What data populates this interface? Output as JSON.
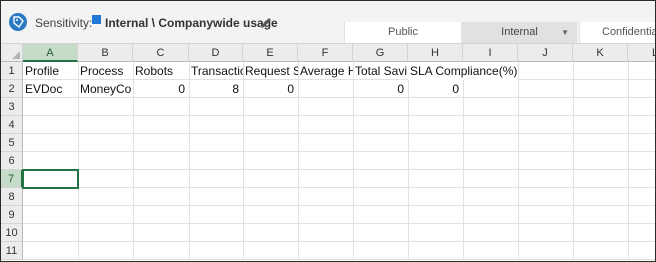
{
  "sensitivity": {
    "label": "Sensitivity:",
    "value": "Internal \\ Companywide usage",
    "levels": [
      "Public",
      "Internal",
      "Confidential"
    ],
    "swatch_color": "#1f77d6"
  },
  "grid": {
    "columns": [
      "A",
      "B",
      "C",
      "D",
      "E",
      "F",
      "G",
      "H",
      "I",
      "J",
      "K",
      "L"
    ],
    "rows": [
      "1",
      "2",
      "3",
      "4",
      "5",
      "6",
      "7",
      "8",
      "9",
      "10",
      "11"
    ],
    "active_column": "A",
    "active_row": "7",
    "row1": {
      "A": "Profile",
      "B": "Process",
      "C": "Robots",
      "D": "Transactic",
      "E": "Request S",
      "F": "Average H",
      "G": "Total Savi",
      "H": "SLA Compliance(%)"
    },
    "row2": {
      "A": "EVDoc",
      "B": "MoneyCo",
      "C": "0",
      "D": "8",
      "E": "0",
      "G": "0",
      "H": "0"
    }
  }
}
